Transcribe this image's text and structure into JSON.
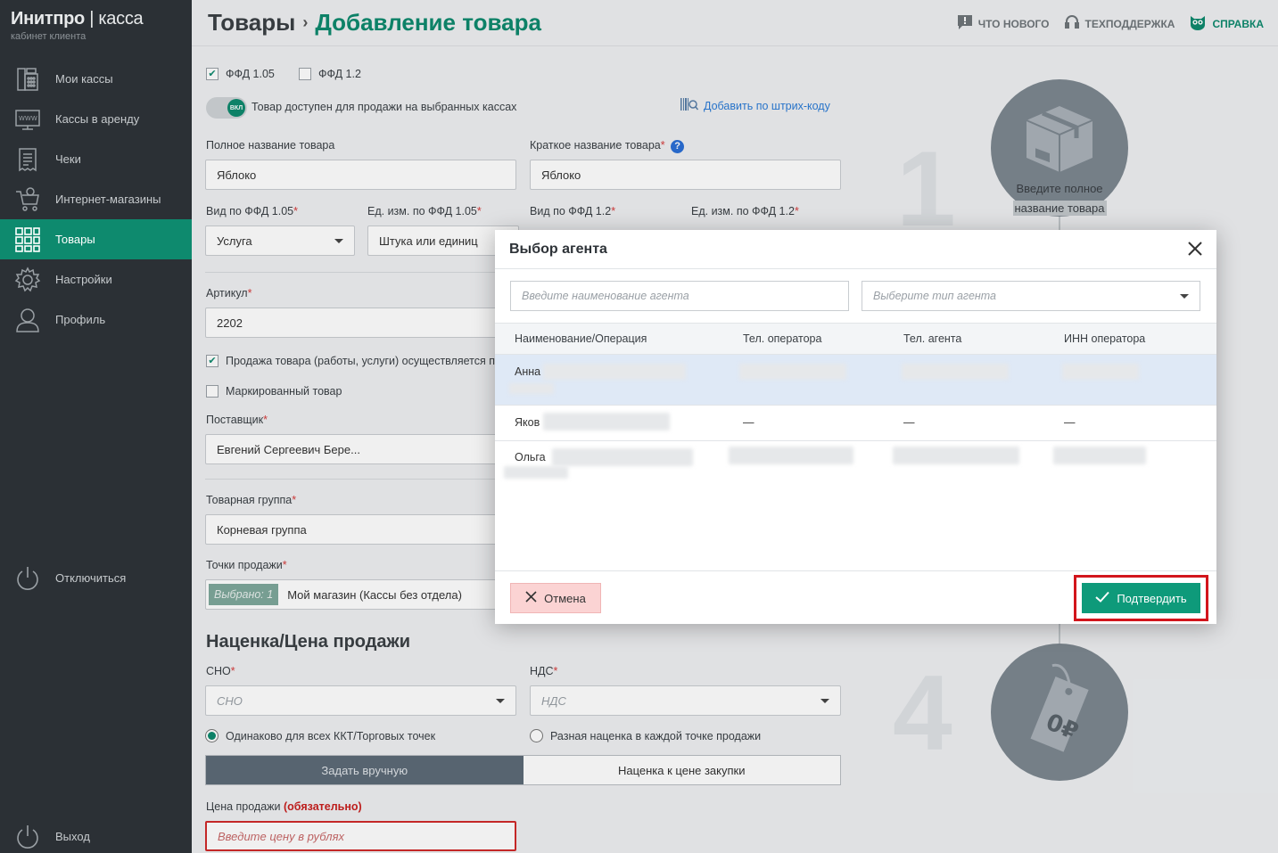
{
  "brand": {
    "name": "Инитпро",
    "sep": "|",
    "product": "касса",
    "subtitle": "кабинет клиента"
  },
  "sidebar": {
    "items": [
      {
        "label": "Мои кассы",
        "icon": "cash-register-icon"
      },
      {
        "label": "Кассы в аренду",
        "icon": "www-monitor-icon"
      },
      {
        "label": "Чеки",
        "icon": "receipt-icon"
      },
      {
        "label": "Интернет-магазины",
        "icon": "shopping-cart-icon"
      },
      {
        "label": "Товары",
        "icon": "grid-icon",
        "active": true
      },
      {
        "label": "Настройки",
        "icon": "gear-icon"
      },
      {
        "label": "Профиль",
        "icon": "user-icon"
      }
    ],
    "disconnect": "Отключиться",
    "logout": "Выход"
  },
  "header": {
    "crumb_root": "Товары",
    "crumb_sep": "›",
    "crumb_current": "Добавление товара",
    "links": {
      "whats_new": "Что нового",
      "support": "Техподдержка",
      "help": "Справка"
    }
  },
  "form": {
    "ffd105": "ФФД 1.05",
    "ffd12": "ФФД 1.2",
    "toggle_knob": "ВКЛ",
    "toggle_label": "Товар доступен для продажи на выбранных кассах",
    "barcode_link": "Добавить по штрих-коду",
    "full_name_label": "Полное название товара",
    "full_name_value": "Яблоко",
    "short_name_label": "Краткое название товара",
    "short_name_value": "Яблоко",
    "kind105_label": "Вид по ФФД 1.05",
    "kind105_value": "Услуга",
    "unit105_label": "Ед. изм. по ФФД 1.05",
    "unit105_value": "Штука или единиц",
    "kind12_label": "Вид по ФФД 1.2",
    "unit12_label": "Ед. изм. по ФФД 1.2",
    "article_label": "Артикул",
    "article_value": "2202",
    "agent_sale_label": "Продажа товара (работы, услуги) осуществляется пла",
    "marked_label": "Маркированный товар",
    "supplier_label": "Поставщик",
    "supplier_value": "Евгений Сергеевич Бере...",
    "group_label": "Товарная группа",
    "group_value": "Корневая группа",
    "points_label": "Точки продажи",
    "points_badge": "Выбрано: 1",
    "points_value": "Мой магазин (Кассы без отдела)",
    "markup_title": "Наценка/Цена продажи",
    "sno_label": "СНО",
    "sno_placeholder": "СНО",
    "nds_label": "НДС",
    "nds_placeholder": "НДС",
    "radio_same": "Одинаково для всех ККТ/Торговых точек",
    "radio_diff": "Разная наценка в каждой точке продажи",
    "seg_manual": "Задать вручную",
    "seg_markup": "Наценка к цене закупки",
    "price_label": "Цена продажи",
    "price_required": "(обязательно)",
    "price_placeholder": "Введите цену в рублях",
    "required_mark": "*"
  },
  "steps": {
    "step1_num": "1",
    "step1_caption_1": "Введите полное",
    "step1_caption_2": "название товара",
    "step4_num": "4",
    "tag_text": "0₽"
  },
  "modal": {
    "title": "Выбор агента",
    "search_placeholder": "Введите наименование агента",
    "type_placeholder": "Выберите тип агента",
    "columns": [
      "Наименование/Операция",
      "Тел. оператора",
      "Тел. агента",
      "ИНН оператора"
    ],
    "rows": [
      {
        "name": "Анна",
        "op_phone": "",
        "agent_phone": "",
        "inn": ""
      },
      {
        "name": "Яков",
        "op_phone": "—",
        "agent_phone": "—",
        "inn": "—"
      },
      {
        "name": "Ольга",
        "op_phone": "",
        "agent_phone": "",
        "inn": ""
      }
    ],
    "cancel": "Отмена",
    "confirm": "Подтвердить"
  },
  "colors": {
    "brand": "#0e8a6e",
    "sidebar": "#2b3035",
    "highlight": "#d2151c",
    "selected_row": "#dfe9f6"
  }
}
